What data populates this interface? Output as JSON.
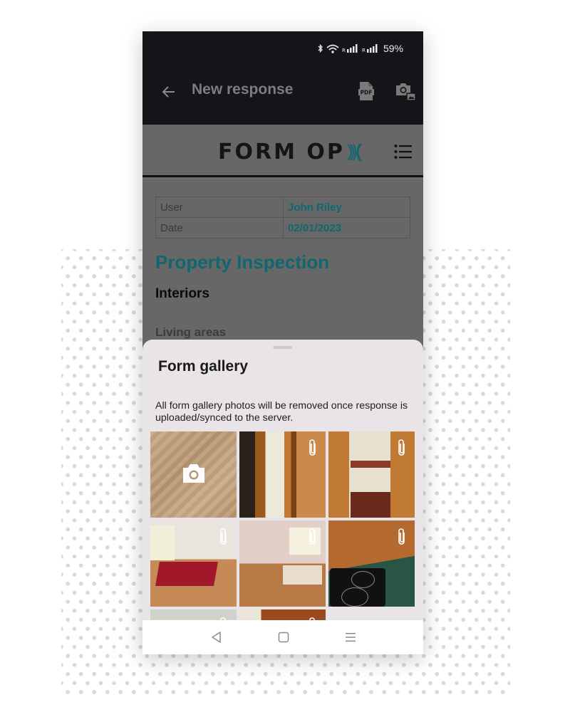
{
  "status_bar": {
    "icons": [
      "bluetooth-icon",
      "wifi-icon",
      "signal-roaming-icon",
      "signal-roaming-icon"
    ],
    "roaming_label": "R",
    "battery": "59%"
  },
  "app_bar": {
    "title": "New response",
    "back_icon": "arrow-left-icon",
    "actions": [
      {
        "name": "export-pdf",
        "icon": "pdf-file-icon",
        "label": "PDF"
      },
      {
        "name": "gallery",
        "icon": "camera-gallery-icon"
      }
    ]
  },
  "brand": {
    "name": "FORM OP",
    "logo_mark": "X",
    "accent_color": "#0f6870",
    "menu_icon": "list-menu-icon"
  },
  "form": {
    "info_rows": [
      {
        "label": "User",
        "value": "John Riley"
      },
      {
        "label": "Date",
        "value": "02/01/2023"
      }
    ],
    "title": "Property Inspection",
    "section": "Interiors",
    "subsection": "Living areas"
  },
  "gallery_sheet": {
    "title": "Form gallery",
    "note": "All form gallery photos will be removed once response is uploaded/synced to the server.",
    "items": [
      {
        "type": "camera",
        "description": "Wooden floor",
        "icon": "camera-icon"
      },
      {
        "type": "photo",
        "description": "Door frame with socket and switch",
        "icon": "paperclip-icon"
      },
      {
        "type": "photo",
        "description": "Bathroom with shower",
        "icon": "paperclip-icon"
      },
      {
        "type": "photo",
        "description": "Bedroom with red bedspread",
        "icon": "paperclip-icon"
      },
      {
        "type": "photo",
        "description": "Bedroom with dresser",
        "icon": "paperclip-icon"
      },
      {
        "type": "photo",
        "description": "Kitchen induction hob",
        "icon": "paperclip-icon"
      },
      {
        "type": "photo",
        "description": "Room with air conditioner",
        "icon": "paperclip-icon"
      },
      {
        "type": "photo",
        "description": "Wooden door",
        "icon": "paperclip-icon"
      }
    ]
  },
  "nav_bar": {
    "buttons": [
      "back-triangle-icon",
      "home-square-icon",
      "recents-menu-icon"
    ]
  }
}
